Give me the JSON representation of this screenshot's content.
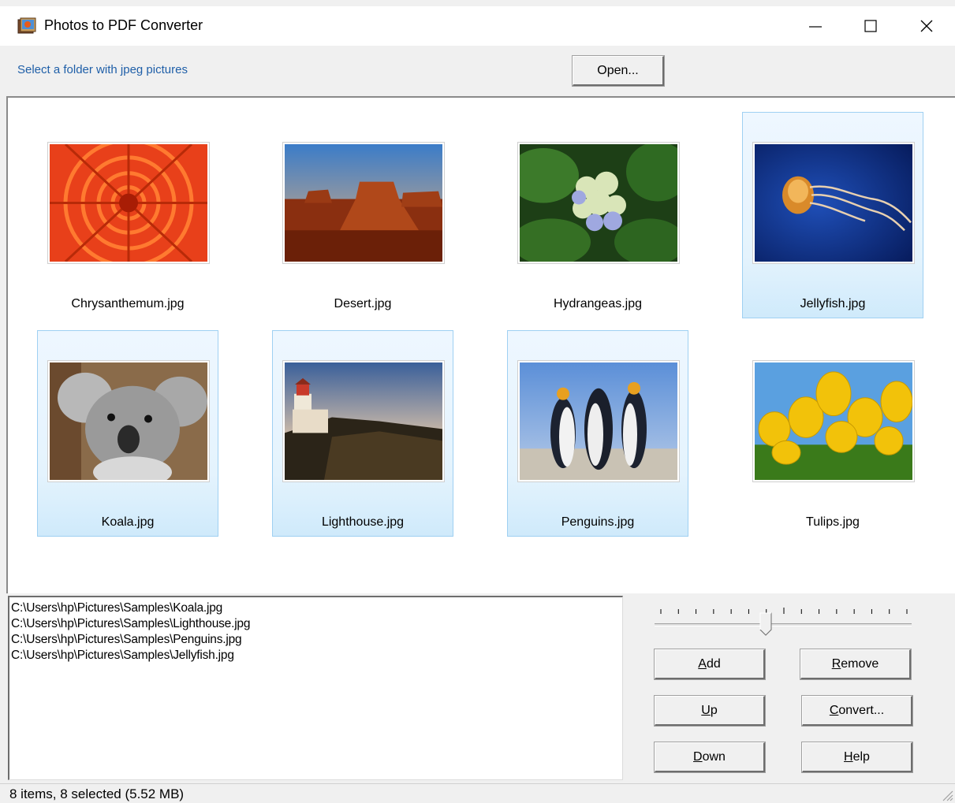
{
  "window": {
    "title": "Photos to PDF Converter",
    "controls": {
      "minimize": "minimize",
      "maximize": "maximize",
      "close": "close"
    }
  },
  "toolbar": {
    "hint": "Select a folder with jpeg pictures",
    "open_label": "Open..."
  },
  "thumbnails": [
    {
      "name": "Chrysanthemum.jpg",
      "selected": false
    },
    {
      "name": "Desert.jpg",
      "selected": false
    },
    {
      "name": "Hydrangeas.jpg",
      "selected": false
    },
    {
      "name": "Jellyfish.jpg",
      "selected": true
    },
    {
      "name": "Koala.jpg",
      "selected": true
    },
    {
      "name": "Lighthouse.jpg",
      "selected": true
    },
    {
      "name": "Penguins.jpg",
      "selected": true
    },
    {
      "name": "Tulips.jpg",
      "selected": false
    }
  ],
  "file_list": [
    "C:\\Users\\hp\\Pictures\\Samples\\Koala.jpg",
    "C:\\Users\\hp\\Pictures\\Samples\\Lighthouse.jpg",
    "C:\\Users\\hp\\Pictures\\Samples\\Penguins.jpg",
    "C:\\Users\\hp\\Pictures\\Samples\\Jellyfish.jpg"
  ],
  "slider": {
    "ticks": 15,
    "value_fraction": 0.44
  },
  "actions": {
    "add": {
      "mnemonic": "A",
      "rest": "dd"
    },
    "remove": {
      "mnemonic": "R",
      "rest": "emove"
    },
    "up": {
      "mnemonic": "U",
      "rest": "p"
    },
    "convert": {
      "mnemonic": "C",
      "rest": "onvert..."
    },
    "down": {
      "mnemonic": "D",
      "rest": "own"
    },
    "help": {
      "mnemonic": "H",
      "rest": "elp"
    }
  },
  "status": {
    "text": "8 items, 8 selected (5.52 MB)"
  },
  "colors": {
    "hint_text": "#1f5fa8",
    "selection_border": "#9fd0f2",
    "selection_fill": "#e4f3fd"
  }
}
